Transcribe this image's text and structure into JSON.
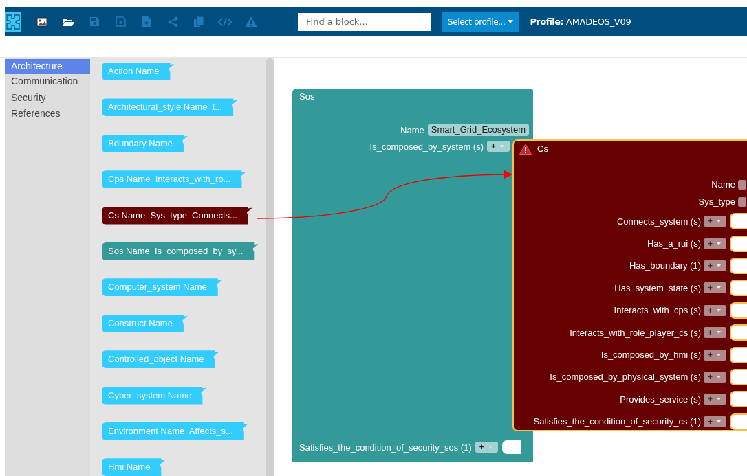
{
  "toolbar": {
    "buttons": [
      {
        "kind": "logo",
        "disabled": false
      },
      {
        "kind": "image",
        "disabled": false
      },
      {
        "kind": "folder",
        "disabled": false
      },
      {
        "kind": "save",
        "disabled": true
      },
      {
        "kind": "save-as",
        "disabled": true
      },
      {
        "kind": "download",
        "disabled": true
      },
      {
        "kind": "share",
        "disabled": true
      },
      {
        "kind": "copy",
        "disabled": true
      },
      {
        "kind": "code",
        "disabled": true
      },
      {
        "kind": "warning",
        "disabled": true
      }
    ],
    "search": {
      "placeholder": "Find a block..."
    },
    "profile_button": {
      "label": "Select profile..."
    },
    "profile": {
      "label": "Profile:",
      "value": "AMADEOS_V09"
    }
  },
  "categories": [
    {
      "label": "Architecture",
      "selected": true
    },
    {
      "label": "Communication",
      "selected": false
    },
    {
      "label": "Security",
      "selected": false
    },
    {
      "label": "References",
      "selected": false
    }
  ],
  "flyout": {
    "blocks": [
      {
        "label": "Action Name",
        "color": "#33ccff"
      },
      {
        "label": "Architectural_style Name  I...",
        "color": "#33ccff"
      },
      {
        "label": "Boundary Name",
        "color": "#33ccff"
      },
      {
        "label": "Cps Name  Interacts_with_ro...",
        "color": "#33ccff"
      },
      {
        "label": "Cs Name  Sys_type  Connects...",
        "color": "#660000"
      },
      {
        "label": "Sos Name  Is_composed_by_sy...",
        "color": "#339999"
      },
      {
        "label": "Computer_system Name",
        "color": "#33ccff"
      },
      {
        "label": "Construct Name",
        "color": "#33ccff"
      },
      {
        "label": "Controlled_object Name",
        "color": "#33ccff"
      },
      {
        "label": "Cyber_system Name",
        "color": "#33ccff"
      },
      {
        "label": "Environment Name  Affects_s...",
        "color": "#33ccff"
      },
      {
        "label": "Hmi Name",
        "color": "#33ccff"
      }
    ]
  },
  "workspace": {
    "sos": {
      "title": "Sos",
      "fields": [
        {
          "kind": "text",
          "label": "Name",
          "value": "Smart_Grid_Ecosystem"
        },
        {
          "kind": "list",
          "label": "Is_composed_by_system (s)",
          "button": "+"
        }
      ],
      "footer": {
        "label": "Satisfies_the_condition_of_security_sos (1)",
        "button": "+"
      }
    },
    "cs": {
      "title": "Cs",
      "warning": true,
      "selected": true,
      "fields": [
        {
          "kind": "text",
          "label": "Name"
        },
        {
          "kind": "text",
          "label": "Sys_type"
        },
        {
          "kind": "list",
          "label": "Connects_system (s)",
          "button": "+"
        },
        {
          "kind": "list",
          "label": "Has_a_rui (s)",
          "button": "+"
        },
        {
          "kind": "list",
          "label": "Has_boundary (1)",
          "button": "+"
        },
        {
          "kind": "list",
          "label": "Has_system_state (s)",
          "button": "+"
        },
        {
          "kind": "list",
          "label": "Interacts_with_cps (s)",
          "button": "+"
        },
        {
          "kind": "list",
          "label": "Interacts_with_role_player_cs (s)",
          "button": "+"
        },
        {
          "kind": "list",
          "label": "Is_composed_by_hmi (s)",
          "button": "+"
        },
        {
          "kind": "list",
          "label": "Is_composed_by_physical_system (s)",
          "button": "+"
        },
        {
          "kind": "list",
          "label": "Provides_service (s)",
          "button": "+"
        },
        {
          "kind": "list",
          "label": "Satisfies_the_condition_of_security_cs (1)",
          "button": "+"
        }
      ]
    }
  }
}
